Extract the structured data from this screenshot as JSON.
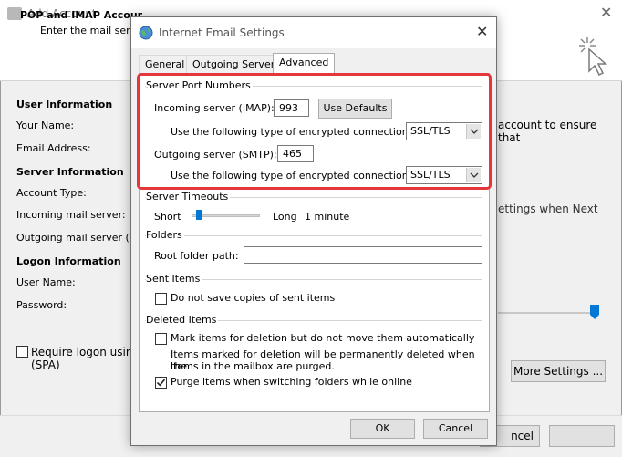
{
  "background_window": {
    "title": "Add Account",
    "header_title": "POP and IMAP Accour",
    "header_subtitle": "Enter the mail server",
    "sections": {
      "user_information": "User Information",
      "server_information": "Server Information",
      "logon_information": "Logon Information"
    },
    "labels": {
      "your_name": "Your Name:",
      "email_address": "Email Address:",
      "account_type": "Account Type:",
      "incoming_mail_server": "Incoming mail server:",
      "outgoing_mail_server": "Outgoing mail server (SM",
      "user_name": "User Name:",
      "password": "Password:"
    },
    "right_text_1": "account to ensure that",
    "right_text_2": "ettings when Next",
    "spa_label_line1": "Require logon using",
    "spa_label_line2": "(SPA)",
    "more_settings_button": "More Settings ...",
    "cancel_button_partial": "ncel"
  },
  "dialog": {
    "title": "Internet Email Settings",
    "tabs": [
      {
        "label": "General",
        "active": false
      },
      {
        "label": "Outgoing Server",
        "active": false
      },
      {
        "label": "Advanced",
        "active": true
      }
    ],
    "server_port_numbers": {
      "group_title": "Server Port Numbers",
      "incoming_label": "Incoming server (IMAP):",
      "incoming_value": "993",
      "use_defaults_button": "Use Defaults",
      "incoming_encryption_label": "Use the following type of encrypted connection:",
      "incoming_encryption_value": "SSL/TLS",
      "outgoing_label": "Outgoing server (SMTP):",
      "outgoing_value": "465",
      "outgoing_encryption_label": "Use the following type of encrypted connection:",
      "outgoing_encryption_value": "SSL/TLS"
    },
    "server_timeouts": {
      "group_title": "Server Timeouts",
      "short_label": "Short",
      "long_label": "Long",
      "value": "1 minute"
    },
    "folders": {
      "group_title": "Folders",
      "root_folder_label": "Root folder path:",
      "root_folder_value": ""
    },
    "sent_items": {
      "group_title": "Sent Items",
      "do_not_save_label": "Do not save copies of sent items",
      "do_not_save_checked": false
    },
    "deleted_items": {
      "group_title": "Deleted Items",
      "mark_for_deletion_label": "Mark items for deletion but do not move them automatically",
      "mark_for_deletion_checked": false,
      "note_line1": "Items marked for deletion will be permanently deleted when the",
      "note_line2": "items in the mailbox are purged.",
      "purge_label": "Purge items when switching folders while online",
      "purge_checked": true
    },
    "ok_button": "OK",
    "cancel_button": "Cancel"
  },
  "colors": {
    "highlight": "#e3373d",
    "slider_thumb": "#0078d7"
  }
}
